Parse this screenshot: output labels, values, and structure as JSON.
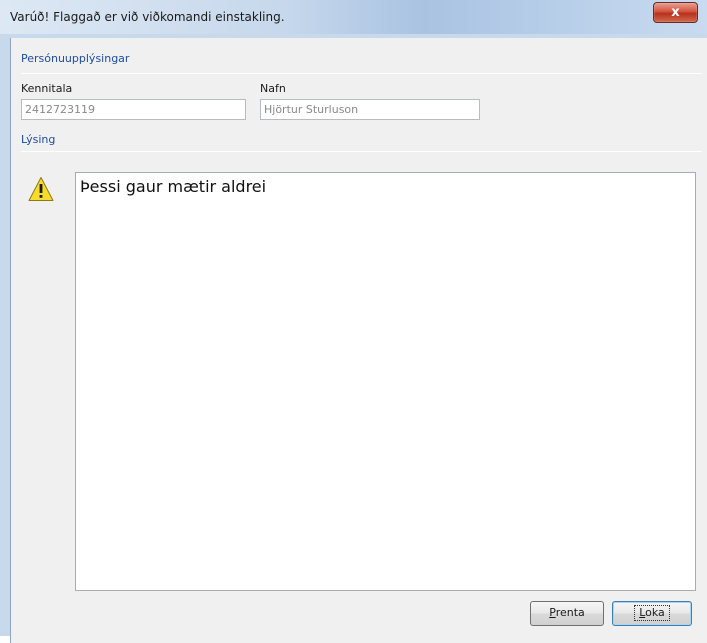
{
  "window": {
    "title": "Varúð! Flaggað er við viðkomandi einstakling.",
    "close_label": "x"
  },
  "personal": {
    "section_label": "Persónuupplýsingar",
    "kennitala_label": "Kennitala",
    "kennitala_value": "2412723119",
    "nafn_label": "Nafn",
    "nafn_value": "Hjörtur Sturluson"
  },
  "description": {
    "section_label": "Lýsing",
    "icon": "warning-icon",
    "text": "Þessi gaur mætir aldrei"
  },
  "buttons": {
    "print_mnemonic": "P",
    "print_rest": "renta",
    "close_mnemonic": "L",
    "close_rest": "oka"
  },
  "colors": {
    "section_label": "#1c4da0",
    "warning_fill": "#f7dc2b",
    "close_button": "#c8412a"
  }
}
